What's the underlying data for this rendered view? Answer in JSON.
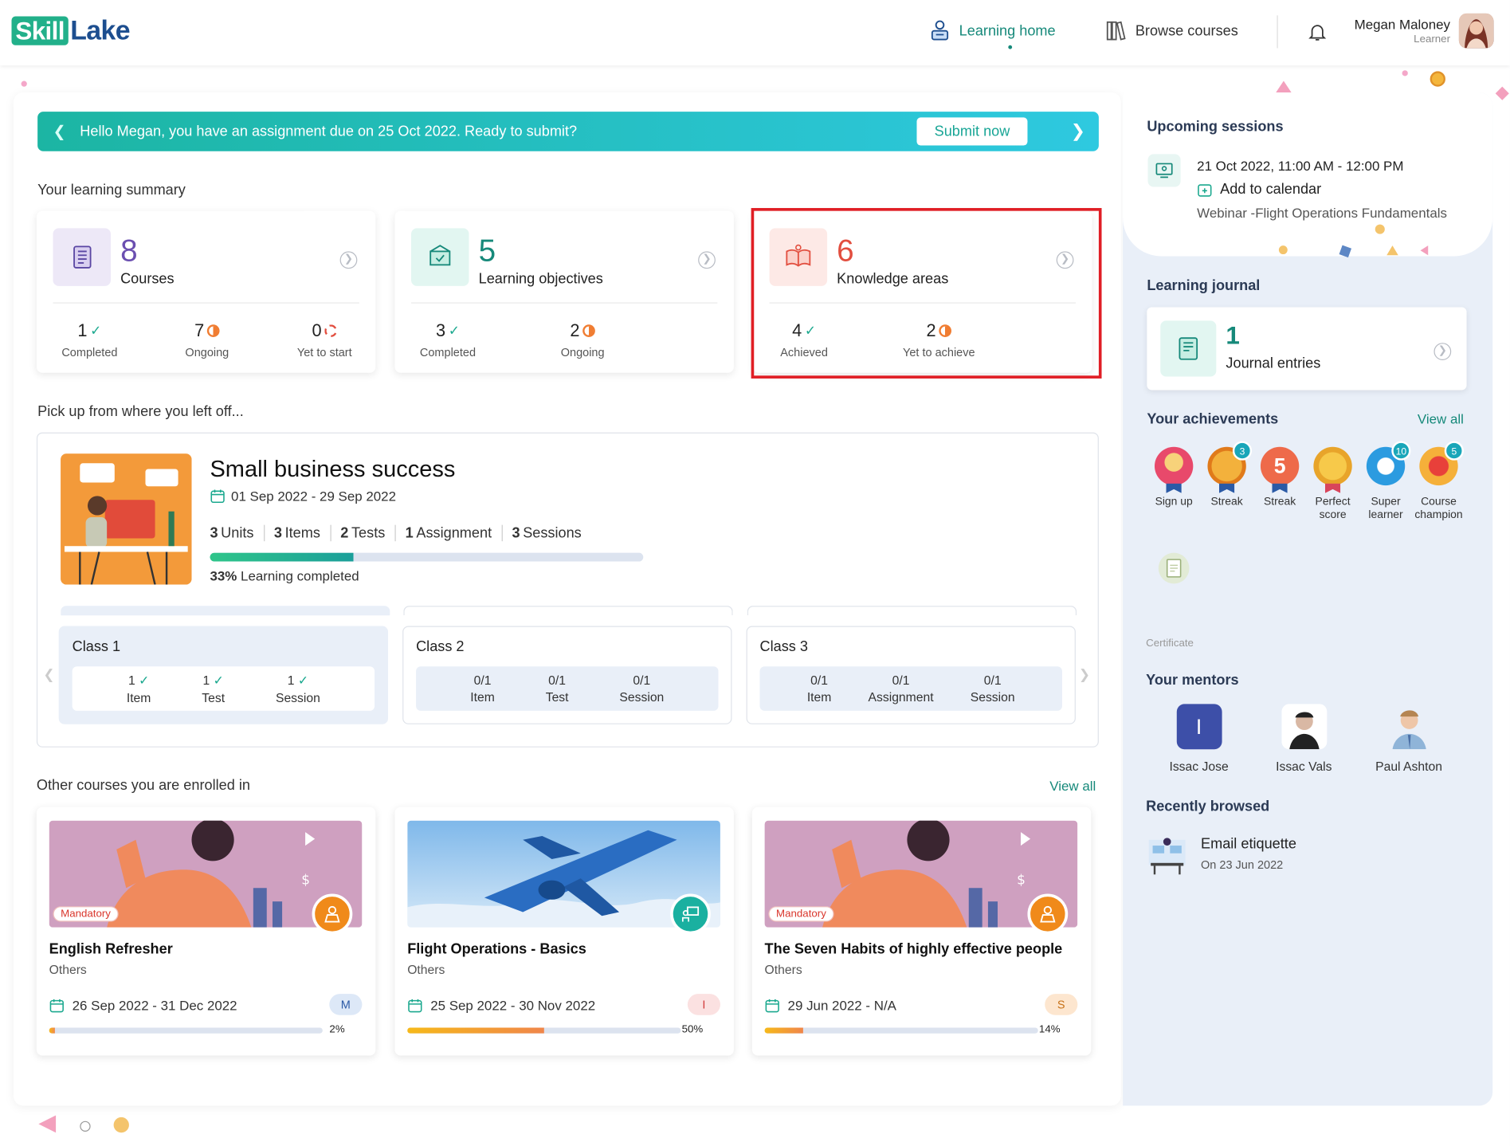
{
  "header": {
    "logo_part1": "Skill",
    "logo_part2": "Lake",
    "nav_home": "Learning home",
    "nav_browse": "Browse courses",
    "user_name": "Megan Maloney",
    "user_role": "Learner"
  },
  "banner": {
    "message": "Hello Megan, you have an assignment due on 25 Oct 2022. Ready to submit?",
    "button": "Submit now"
  },
  "summary": {
    "title": "Your learning summary",
    "courses": {
      "count": "8",
      "label": "Courses",
      "completed": "1",
      "completed_l": "Completed",
      "ongoing": "7",
      "ongoing_l": "Ongoing",
      "yet": "0",
      "yet_l": "Yet to start"
    },
    "objectives": {
      "count": "5",
      "label": "Learning objectives",
      "completed": "3",
      "completed_l": "Completed",
      "ongoing": "2",
      "ongoing_l": "Ongoing"
    },
    "knowledge": {
      "count": "6",
      "label": "Knowledge areas",
      "achieved": "4",
      "achieved_l": "Achieved",
      "yet": "2",
      "yet_l": "Yet to achieve"
    }
  },
  "pickup": {
    "title": "Pick up from where you left off...",
    "course": "Small business success",
    "dates": "01 Sep 2022 - 29 Sep 2022",
    "meta": [
      {
        "n": "3",
        "l": "Units"
      },
      {
        "n": "3",
        "l": "Items"
      },
      {
        "n": "2",
        "l": "Tests"
      },
      {
        "n": "1",
        "l": "Assignment"
      },
      {
        "n": "3",
        "l": "Sessions"
      }
    ],
    "progress": 0.33,
    "pct": "33%",
    "pct_label": "Learning completed",
    "classes": [
      {
        "name": "Class 1",
        "items": [
          {
            "n": "1",
            "l": "Item"
          },
          {
            "n": "1",
            "l": "Test"
          },
          {
            "n": "1",
            "l": "Session"
          }
        ]
      },
      {
        "name": "Class 2",
        "items": [
          {
            "n": "0/1",
            "l": "Item"
          },
          {
            "n": "0/1",
            "l": "Test"
          },
          {
            "n": "0/1",
            "l": "Session"
          }
        ]
      },
      {
        "name": "Class 3",
        "items": [
          {
            "n": "0/1",
            "l": "Item"
          },
          {
            "n": "0/1",
            "l": "Assignment"
          },
          {
            "n": "0/1",
            "l": "Session"
          }
        ]
      }
    ]
  },
  "other": {
    "title": "Other courses you are enrolled in",
    "view_all": "View all",
    "courses": [
      {
        "title": "English Refresher",
        "cat": "Others",
        "dates": "26 Sep 2022 - 31 Dec 2022",
        "level": "M",
        "pct": "2%",
        "progress": 0.02,
        "badge": "Mandatory"
      },
      {
        "title": "Flight Operations - Basics",
        "cat": "Others",
        "dates": "25 Sep 2022 - 30 Nov 2022",
        "level": "I",
        "pct": "50%",
        "progress": 0.5
      },
      {
        "title": "The Seven Habits of highly effective people",
        "cat": "Others",
        "dates": "29 Jun 2022 - N/A",
        "level": "S",
        "pct": "14%",
        "progress": 0.14,
        "badge": "Mandatory"
      }
    ]
  },
  "sidebar": {
    "upcoming_title": "Upcoming sessions",
    "session_time": "21 Oct 2022, 11:00 AM - 12:00 PM",
    "add_calendar": "Add to calendar",
    "session_name": "Webinar -Flight Operations Fundamentals",
    "journal_title": "Learning journal",
    "journal_count": "1",
    "journal_label": "Journal entries",
    "ach_title": "Your achievements",
    "ach_view_all": "View all",
    "achievements": [
      {
        "label": "Sign up",
        "count": ""
      },
      {
        "label": "Streak",
        "count": "3"
      },
      {
        "label": "Streak",
        "count": ""
      },
      {
        "label": "Perfect score",
        "count": ""
      },
      {
        "label": "Super learner",
        "count": "10"
      },
      {
        "label": "Course champion",
        "count": "5"
      }
    ],
    "streak_big": "5",
    "certificate": "Certificate",
    "mentors_title": "Your mentors",
    "mentors": [
      {
        "name": "Issac Jose",
        "initial": "I"
      },
      {
        "name": "Issac Vals"
      },
      {
        "name": "Paul Ashton"
      }
    ],
    "recent_title": "Recently browsed",
    "recent_item": "Email etiquette",
    "recent_date": "On 23 Jun 2022"
  },
  "colors": {
    "accent": "#16897a",
    "highlight": "#e01e25",
    "courses": "#6b4fb0",
    "objectives": "#16897a",
    "knowledge": "#e24e3f"
  }
}
